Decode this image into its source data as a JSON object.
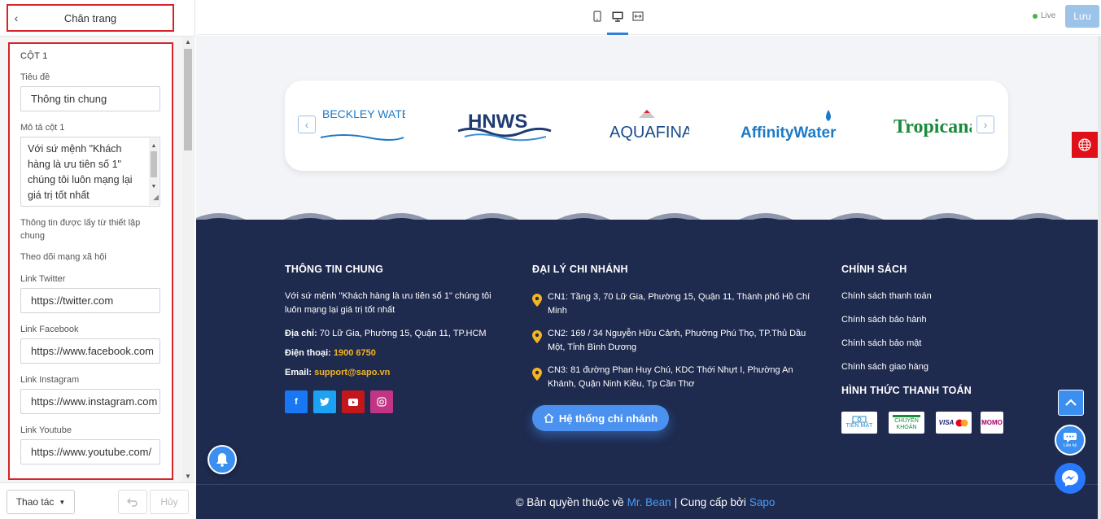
{
  "panel": {
    "title": "Chân trang",
    "section_title": "CỘT 1",
    "fields": {
      "title_label": "Tiêu đề",
      "title_value": "Thông tin chung",
      "desc_label": "Mô tả cột 1",
      "desc_value": "Với sứ mệnh \"Khách hàng là ưu tiên số 1\" chúng tôi luôn mạng lại giá trị tốt nhất",
      "note": "Thông tin được lấy từ thiết lập chung",
      "social_heading": "Theo dõi mạng xã hội",
      "twitter_label": "Link Twitter",
      "twitter_value": "https://twitter.com",
      "facebook_label": "Link Facebook",
      "facebook_value": "https://www.facebook.com",
      "instagram_label": "Link Instagram",
      "instagram_value": "https://www.instagram.com",
      "youtube_label": "Link Youtube",
      "youtube_value": "https://www.youtube.com/"
    },
    "footer": {
      "actions_label": "Thao tác",
      "cancel_label": "Hủy"
    }
  },
  "topbar": {
    "live_label": "Live",
    "save_label": "Lưu"
  },
  "brands": [
    "BECKLEY WATER",
    "HNWS",
    "AQUAFINA",
    "AffinityWater",
    "Tropicana"
  ],
  "footer_site": {
    "col1": {
      "heading": "THÔNG TIN CHUNG",
      "desc": "Với sứ mệnh \"Khách hàng là ưu tiên số 1\" chúng tôi luôn mạng lại giá trị tốt nhất",
      "address_label": "Địa chỉ:",
      "address": "70 Lữ Gia, Phường 15, Quận 11, TP.HCM",
      "phone_label": "Điện thoại:",
      "phone": "1900 6750",
      "email_label": "Email:",
      "email": "support@sapo.vn"
    },
    "col2": {
      "heading": "ĐẠI LÝ CHI NHÁNH",
      "branches": [
        "CN1: Tầng 3, 70 Lữ Gia, Phường 15, Quận 11, Thành phố Hồ Chí Minh",
        "CN2: 169 / 34 Nguyễn Hữu Cảnh, Phường Phú Thọ, TP.Thủ Dầu Một, Tỉnh Bình Dương",
        "CN3: 81 đường Phan Huy Chú, KDC Thới Nhựt I, Phường An Khánh, Quận Ninh Kiều, Tp Cần Thơ"
      ],
      "button": "Hệ thống chi nhánh"
    },
    "col3": {
      "heading": "CHÍNH SÁCH",
      "links": [
        "Chính sách thanh toán",
        "Chính sách bảo hành",
        "Chính sách bảo mật",
        "Chính sách giao hàng"
      ],
      "pay_heading": "HÌNH THỨC THANH TOÁN",
      "pay_methods": [
        "TIỀN MẶT",
        "CHUYỂN KHOẢN",
        "VISA",
        "MOMO"
      ]
    },
    "copyright": {
      "prefix": "© Bản quyền thuộc về",
      "owner": "Mr. Bean",
      "middle": "| Cung cấp bởi",
      "provider": "Sapo"
    },
    "contact_label": "Liên hệ"
  },
  "colors": {
    "footer_bg": "#1e2a4e",
    "accent": "#3b8ff0",
    "highlight": "#f5b51e",
    "panel_border": "#d8232a"
  }
}
